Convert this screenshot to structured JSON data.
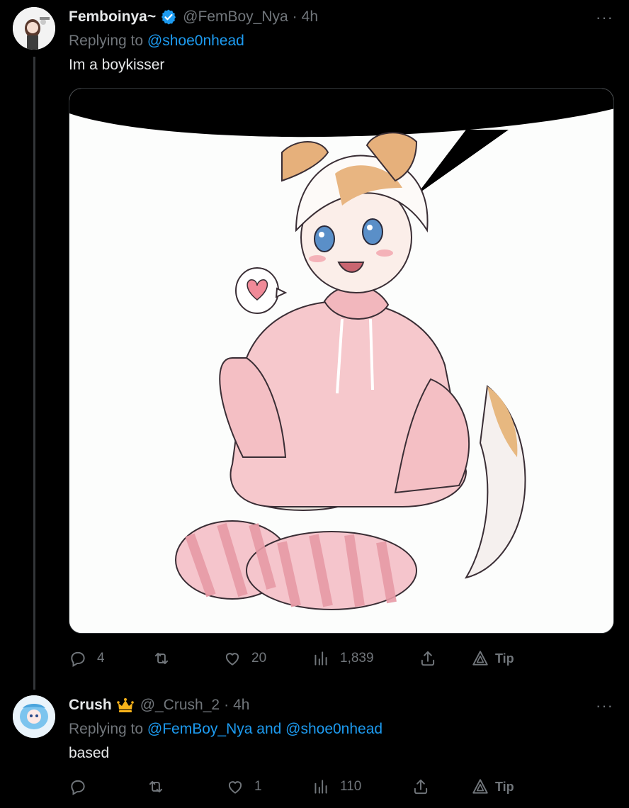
{
  "tweets": [
    {
      "name": "Femboinya~",
      "handle": "@FemBoy_Nya",
      "time": "4h",
      "replying_label": "Replying to",
      "replying_to": "@shoe0nhead",
      "text": "Im a boykisser",
      "actions": {
        "replies": "4",
        "retweets": "",
        "likes": "20",
        "views": "1,839",
        "tip": "Tip"
      },
      "more": "···"
    },
    {
      "name": "Crush",
      "handle": "@_Crush_2",
      "time": "4h",
      "replying_label": "Replying to",
      "replying_to": "@FemBoy_Nya and @shoe0nhead",
      "text": "based",
      "actions": {
        "replies": "",
        "retweets": "",
        "likes": "1",
        "views": "110",
        "tip": "Tip"
      },
      "more": "···"
    }
  ],
  "colors": {
    "background": "#000000",
    "text": "#e7e9ea",
    "muted": "#71767b",
    "link": "#1d9bf0",
    "verified": "#1d9bf0",
    "badge_gold": "#f6b21a"
  },
  "icons": {
    "verified": "verified-badge-icon",
    "reply": "reply-icon",
    "retweet": "retweet-icon",
    "like": "heart-icon",
    "views": "views-bar-chart-icon",
    "share": "share-icon",
    "tip": "tip-icon",
    "crown": "crown-badge-icon"
  }
}
